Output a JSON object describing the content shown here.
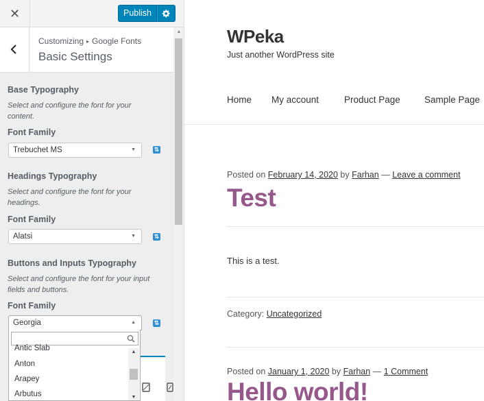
{
  "customizer": {
    "close_glyph": "✕",
    "publish_label": "Publish",
    "crumb_parent": "Customizing",
    "crumb_sep": "▸",
    "crumb_panel": "Google Fonts",
    "section_title": "Basic Settings",
    "controls": [
      {
        "title": "Base Typography",
        "description": "Select and configure the font for your content.",
        "label": "Font Family",
        "value": "Trebuchet MS"
      },
      {
        "title": "Headings Typography",
        "description": "Select and configure the font for your headings.",
        "label": "Font Family",
        "value": "Alatsi"
      },
      {
        "title": "Buttons and Inputs Typography",
        "description": "Select and configure the font for your input fields and buttons.",
        "label": "Font Family",
        "value": "Georgia"
      }
    ],
    "dropdown": {
      "search_value": "",
      "options": [
        "Antic Slab",
        "Anton",
        "Arapey",
        "Arbutus"
      ]
    },
    "accent_color": "#0085ba"
  },
  "preview": {
    "site_title": "WPeka",
    "site_description": "Just another WordPress site",
    "nav": [
      "Home",
      "My account",
      "Product Page",
      "Sample Page"
    ],
    "posts": [
      {
        "posted_on": "Posted on",
        "date": "February 14, 2020",
        "by": "by",
        "author": "Farhan",
        "dash": "—",
        "comments": "Leave a comment",
        "title": "Test",
        "content": "This is a test.",
        "category_label": "Category:",
        "category": "Uncategorized"
      },
      {
        "posted_on": "Posted on",
        "date": "January 1, 2020",
        "by": "by",
        "author": "Farhan",
        "dash": "—",
        "comments": "1 Comment",
        "title": "Hello world!"
      }
    ],
    "title_color": "#96588a"
  }
}
